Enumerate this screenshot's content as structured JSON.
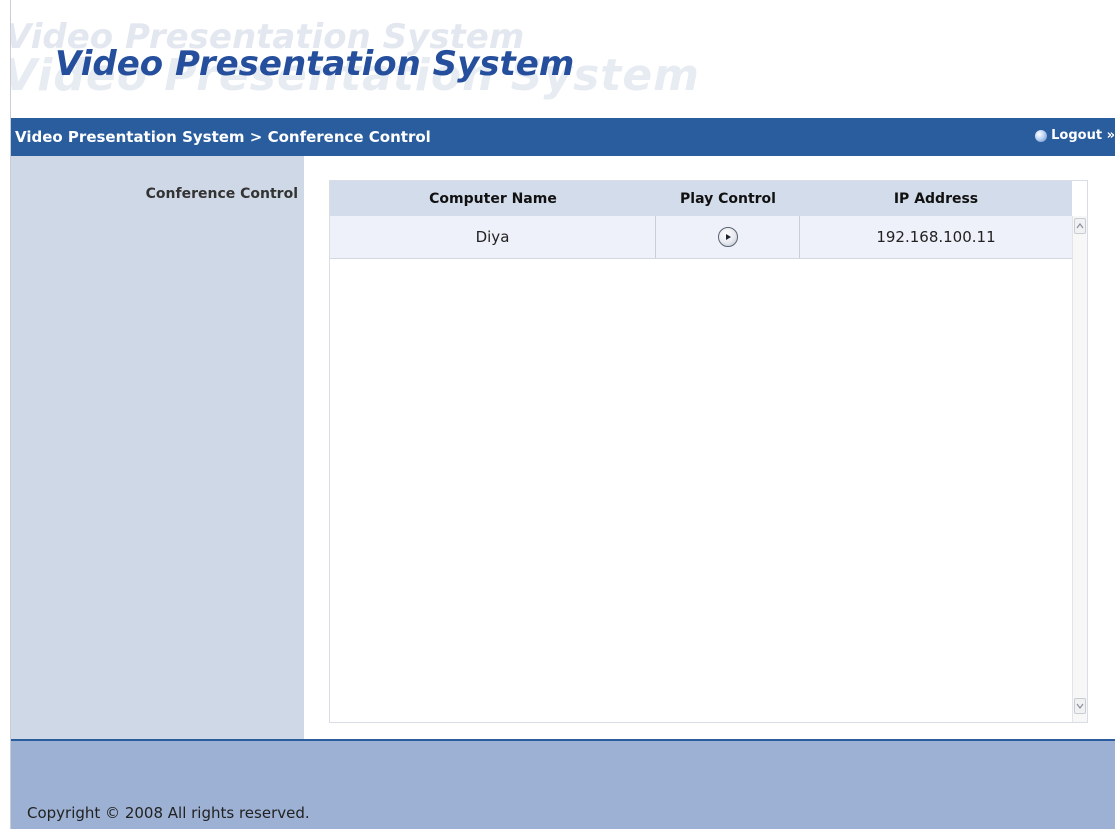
{
  "header": {
    "title": "Video Presentation System",
    "watermark": "Video Presentation System"
  },
  "navbar": {
    "breadcrumb": "Video Presentation System > Conference Control",
    "logout_label": "Logout »"
  },
  "sidebar": {
    "title": "Conference Control"
  },
  "table": {
    "columns": [
      "Computer Name",
      "Play Control",
      "IP Address"
    ],
    "rows": [
      {
        "computer_name": "Diya",
        "play_icon": "play-icon",
        "ip_address": "192.168.100.11"
      }
    ]
  },
  "footer": {
    "copyright": "Copyright © 2008 All rights reserved."
  },
  "colors": {
    "title": "#254f9c",
    "navbar": "#2a5d9e",
    "sidebar": "#cfd8e6",
    "table_header": "#d3dcea",
    "footer": "#9cb1d3"
  }
}
